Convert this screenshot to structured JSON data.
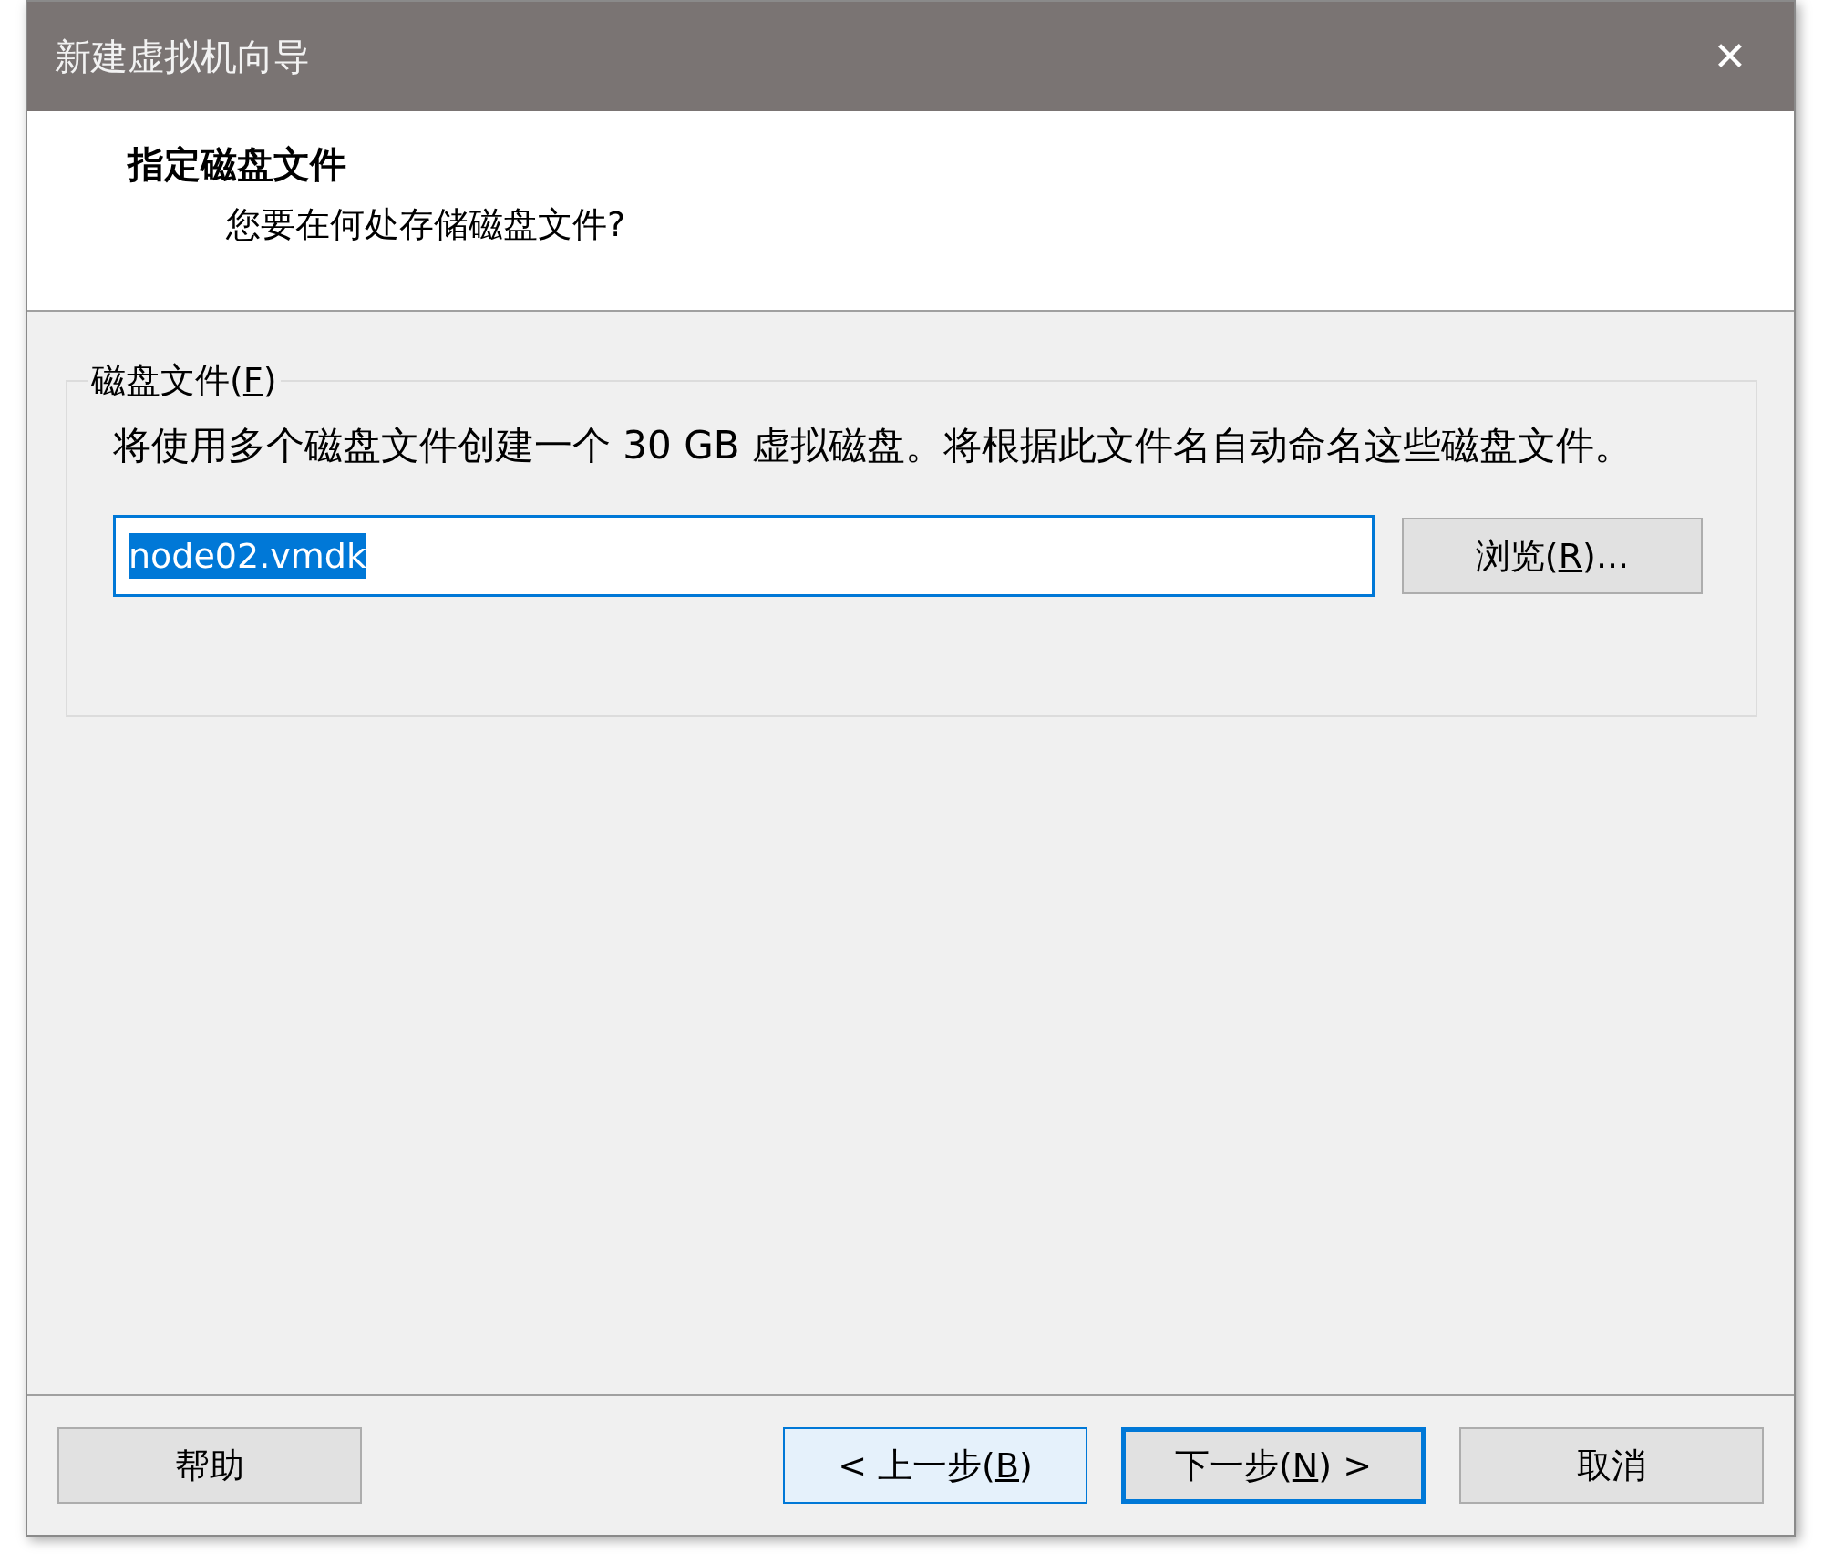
{
  "window": {
    "title": "新建虚拟机向导",
    "close": "✕"
  },
  "header": {
    "title": "指定磁盘文件",
    "subtitle": "您要在何处存储磁盘文件?"
  },
  "group": {
    "legend": {
      "before": "磁盘文件(",
      "key": "F",
      "after": ")"
    },
    "description": "将使用多个磁盘文件创建一个 30 GB 虚拟磁盘。将根据此文件名自动命名这些磁盘文件。",
    "file_field": {
      "value": "node02.vmdk",
      "selected": true,
      "focused": true
    },
    "browse": {
      "before": "浏览(",
      "key": "R",
      "after": ")..."
    }
  },
  "buttons": [
    {
      "before": "帮助",
      "kind": "normal"
    },
    {
      "before": "< 上一步(",
      "key": "B",
      "after": ")",
      "kind": "hover"
    },
    {
      "before": "下一步(",
      "key": "N",
      "after": ") >",
      "kind": "default"
    },
    {
      "before": "取消",
      "kind": "normal"
    }
  ]
}
